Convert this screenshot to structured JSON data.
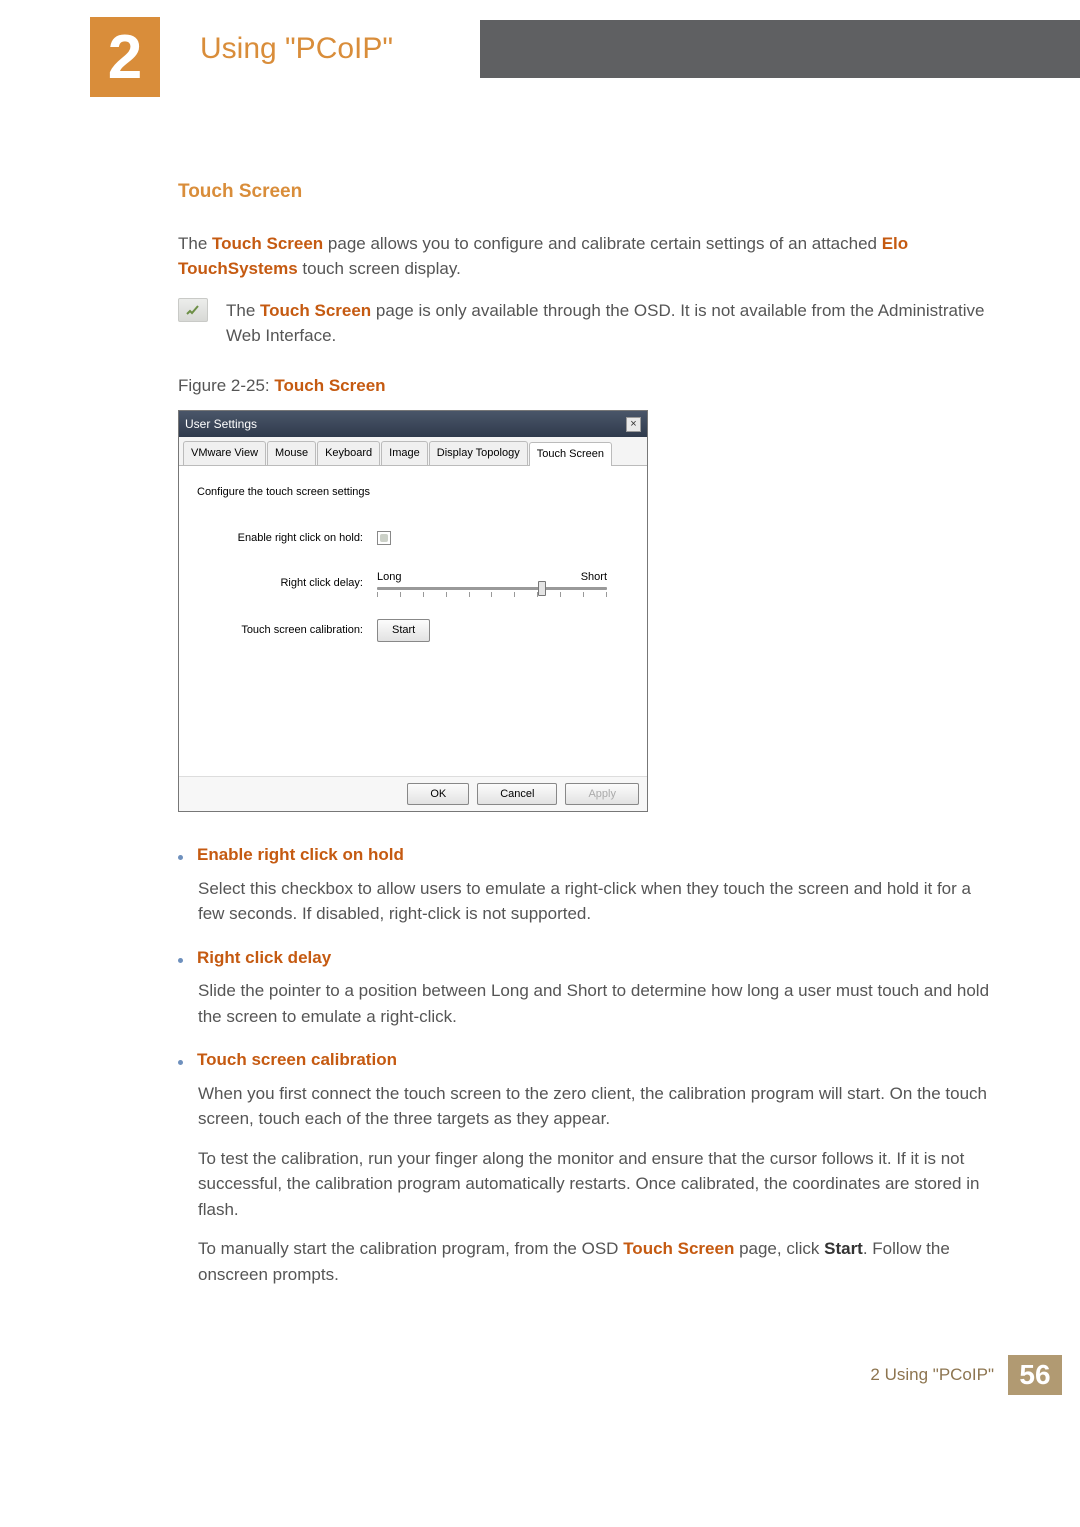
{
  "chapter": {
    "number": "2",
    "title": "Using \"PCoIP\""
  },
  "section": {
    "heading": "Touch Screen",
    "intro_para_prefix": "The ",
    "intro_para_strong1": "Touch Screen",
    "intro_para_mid": " page allows you to configure and calibrate certain settings of an attached ",
    "intro_para_strong2": "Elo TouchSystems",
    "intro_para_suffix": " touch screen display.",
    "note_prefix": "The ",
    "note_strong": "Touch Screen",
    "note_rest": " page is only available through the OSD. It is not available from the Administrative Web Interface.",
    "figure_prefix": "Figure 2-25: ",
    "figure_strong": "Touch Screen"
  },
  "dialog": {
    "title": "User Settings",
    "close": "×",
    "tabs": [
      "VMware View",
      "Mouse",
      "Keyboard",
      "Image",
      "Display Topology",
      "Touch Screen"
    ],
    "active_tab_idx": 5,
    "heading": "Configure the touch screen settings",
    "row1_label": "Enable right click on hold:",
    "row2_label": "Right click delay:",
    "slider_left": "Long",
    "slider_right": "Short",
    "row3_label": "Touch screen calibration:",
    "start_btn": "Start",
    "ok": "OK",
    "cancel": "Cancel",
    "apply": "Apply"
  },
  "bullets": [
    {
      "title": "Enable right click on hold",
      "paras": [
        "Select this checkbox to allow users to emulate a right-click when they touch the screen and hold it for a few seconds. If disabled, right-click is not supported."
      ]
    },
    {
      "title": "Right click delay",
      "paras": [
        "Slide the pointer to a position between Long and Short to determine how long a user must touch and hold the screen to emulate a right-click."
      ]
    },
    {
      "title": "Touch screen calibration",
      "paras": [
        "When you first connect the touch screen to the zero client, the calibration program will start. On the touch screen, touch each of the three targets as they appear.",
        "To test the calibration, run your finger along the monitor and ensure that the cursor follows it. If it is not successful, the calibration program automatically restarts. Once calibrated, the coordinates are stored in flash."
      ],
      "final_pre": "To manually start the calibration program, from the OSD ",
      "final_strong1": "Touch Screen",
      "final_mid": " page, click ",
      "final_strong2": "Start",
      "final_post": ". Follow the onscreen prompts."
    }
  ],
  "footer": {
    "text": "2 Using \"PCoIP\"",
    "page": "56"
  }
}
